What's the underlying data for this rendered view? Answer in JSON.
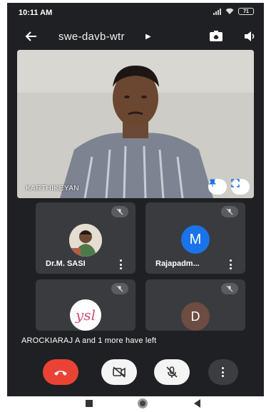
{
  "status_bar": {
    "time": "10:11 AM",
    "battery": "71"
  },
  "header": {
    "meeting_code": "swe-davb-wtr"
  },
  "main_video": {
    "participant_name": "KARTHIKEYAN"
  },
  "participants": [
    {
      "name": "Dr.M. SASI",
      "avatar": "photo",
      "muted": true
    },
    {
      "name": "Rajapadm...",
      "avatar_letter": "M",
      "avatar_color": "#1a73e8",
      "muted": true
    },
    {
      "name": "",
      "avatar_text": "ysl",
      "avatar_color": "#ffffff",
      "muted": true
    },
    {
      "name": "",
      "avatar_letter": "D",
      "avatar_color": "#6d4c41",
      "muted": true
    }
  ],
  "notice": {
    "text": "AROCKIARAJ A and 1 more have left"
  },
  "colors": {
    "end_call": "#ea4335",
    "background": "#1f2023",
    "tile": "#3a3b3e"
  },
  "icons": [
    "back-arrow-icon",
    "switch-camera-icon",
    "speaker-icon",
    "pin-icon",
    "fullscreen-icon",
    "mic-off-icon",
    "camera-off-icon",
    "end-call-icon",
    "more-vert-icon"
  ]
}
